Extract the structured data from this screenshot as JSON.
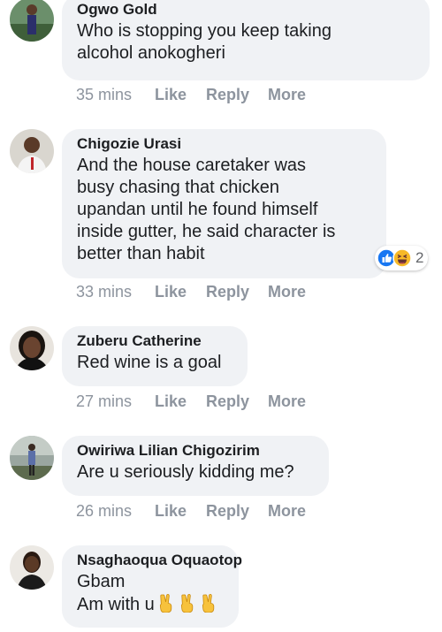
{
  "comments": [
    {
      "author": "Ogwo Gold",
      "text": "Who is stopping you keep taking\nalcohol anokogheri",
      "time": "35 mins",
      "like": "Like",
      "reply": "Reply",
      "more": "More"
    },
    {
      "author": "Chigozie Urasi",
      "text": "And the house caretaker was\nbusy chasing that chicken\nupandan until he found himself\ninside gutter, he said character is\nbetter than habit",
      "time": "33 mins",
      "like": "Like",
      "reply": "Reply",
      "more": "More",
      "reactions": {
        "icons": [
          "like-reaction-icon",
          "haha-reaction-icon"
        ],
        "count": "2"
      }
    },
    {
      "author": "Zuberu Catherine",
      "text": "Red wine is a goal",
      "time": "27 mins",
      "like": "Like",
      "reply": "Reply",
      "more": "More"
    },
    {
      "author": "Owiriwa Lilian Chigozirim",
      "text": "Are u seriously kidding me?",
      "time": "26 mins",
      "like": "Like",
      "reply": "Reply",
      "more": "More"
    },
    {
      "author": "Nsaghaoqua Oquaotop",
      "text_line1": "Gbam",
      "text_line2": "Am with u",
      "emoji": [
        "victory-hand-icon",
        "victory-hand-icon",
        "victory-hand-icon"
      ]
    }
  ],
  "colors": {
    "bubble": "#f0f2f5",
    "text": "#1c1e21",
    "meta": "#8d949e",
    "like_blue": "#1877f2",
    "haha_yellow": "#f7b928"
  }
}
